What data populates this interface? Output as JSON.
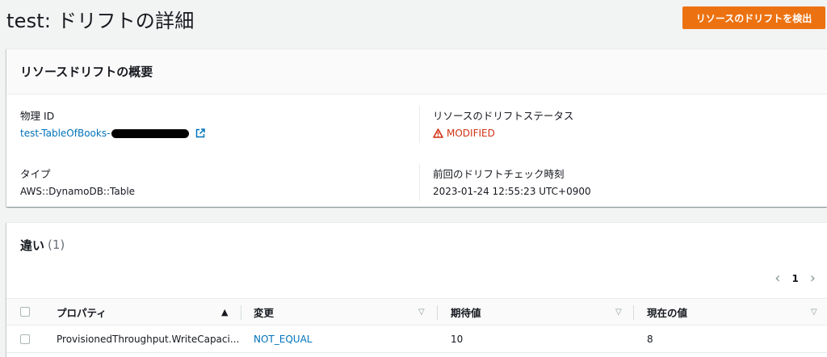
{
  "page": {
    "title": "test: ドリフトの詳細",
    "detect_button": "リソースのドリフトを検出"
  },
  "summary": {
    "title": "リソースドリフトの概要",
    "physical_id_label": "物理 ID",
    "physical_id_value": "test-TableOfBooks-",
    "type_label": "タイプ",
    "type_value": "AWS::DynamoDB::Table",
    "drift_status_label": "リソースのドリフトステータス",
    "drift_status_value": "MODIFIED",
    "last_check_label": "前回のドリフトチェック時刻",
    "last_check_value": "2023-01-24 12:55:23 UTC+0900",
    "colors": {
      "status": "#d13212",
      "link": "#0073bb"
    }
  },
  "differences": {
    "title": "違い",
    "count": "(1)",
    "pagination": {
      "current_page": "1"
    },
    "columns": [
      "プロパティ",
      "変更",
      "期待値",
      "現在の値"
    ],
    "rows": [
      {
        "property": "ProvisionedThroughput.WriteCapaci...",
        "change": "NOT_EQUAL",
        "expected": "10",
        "actual": "8"
      }
    ]
  },
  "theme": {
    "accent": "#ec7211"
  }
}
